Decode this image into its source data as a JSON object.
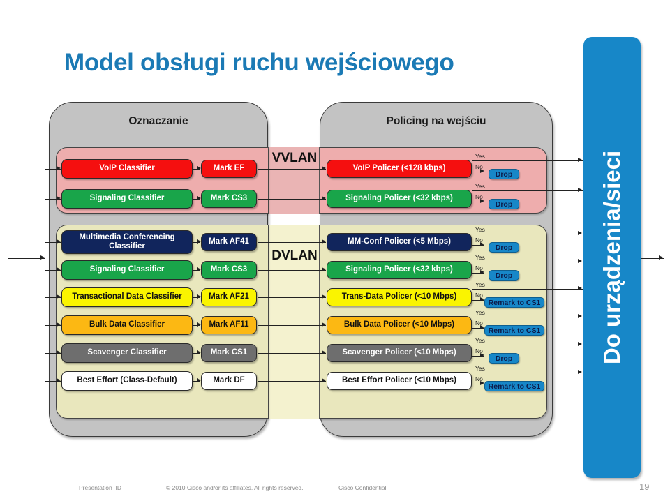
{
  "slide": {
    "title": "Model obsługi ruchu wejściowego",
    "stage_left_label": "Oznaczanie",
    "stage_right_label": "Policing na wejściu",
    "vlan_voice": "VVLAN",
    "vlan_data": "DVLAN",
    "output_bar": "Do urządzenia/sieci",
    "accent_color": "#1787c8",
    "title_color": "#1b7ab5"
  },
  "yes_label": "Yes",
  "no_label": "No",
  "rows": [
    {
      "group": "voice",
      "classifier": "VoIP Classifier",
      "marker": "Mark EF",
      "policer": "VoIP Policer (<128 kbps)",
      "action": "Drop",
      "color": "#f50f0f"
    },
    {
      "group": "voice",
      "classifier": "Signaling Classifier",
      "marker": "Mark CS3",
      "policer": "Signaling Policer (<32 kbps)",
      "action": "Drop",
      "color": "#19a54a"
    },
    {
      "group": "data",
      "classifier": "Multimedia Conferencing Classifier",
      "marker": "Mark AF41",
      "policer": "MM-Conf Policer (<5 Mbps)",
      "action": "Drop",
      "color": "#11255c"
    },
    {
      "group": "data",
      "classifier": "Signaling Classifier",
      "marker": "Mark CS3",
      "policer": "Signaling Policer (<32 kbps)",
      "action": "Drop",
      "color": "#19a54a"
    },
    {
      "group": "data",
      "classifier": "Transactional Data Classifier",
      "marker": "Mark AF21",
      "policer": "Trans-Data Policer (<10 Mbps)",
      "action": "Remark  to CS1",
      "color": "#faf400"
    },
    {
      "group": "data",
      "classifier": "Bulk Data Classifier",
      "marker": "Mark AF11",
      "policer": "Bulk Data Policer (<10 Mbps)",
      "action": "Remark  to CS1",
      "color": "#fcb813"
    },
    {
      "group": "data",
      "classifier": "Scavenger Classifier",
      "marker": "Mark CS1",
      "policer": "Scavenger Policer (<10 Mbps)",
      "action": "Drop",
      "color": "#6e6e6e"
    },
    {
      "group": "data",
      "classifier": "Best Effort (Class-Default)",
      "marker": "Mark DF",
      "policer": "Best Effort Policer (<10 Mbps)",
      "action": "Remark  to CS1",
      "color": "#ffffff"
    }
  ],
  "footer": {
    "presentation_id": "Presentation_ID",
    "copyright": "© 2010 Cisco and/or its affiliates. All rights reserved.",
    "confidential": "Cisco Confidential",
    "page_number": "19"
  }
}
